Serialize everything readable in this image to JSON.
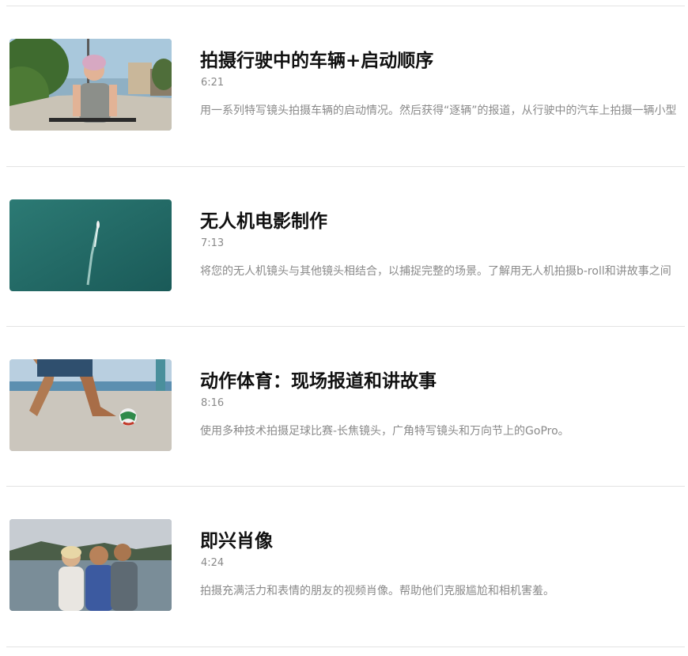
{
  "videos": [
    {
      "title": "拍摄行驶中的车辆+启动顺序",
      "duration": "6:21",
      "description": "用一系列特写镜头拍摄车辆的启动情况。然后获得“逐辆”的报道，从行驶中的汽车上拍摄一辆小型"
    },
    {
      "title": "无人机电影制作",
      "duration": "7:13",
      "description": "将您的无人机镜头与其他镜头相结合，以捕捉完整的场景。了解用无人机拍摄b-roll和讲故事之间"
    },
    {
      "title": "动作体育：现场报道和讲故事",
      "duration": "8:16",
      "description": "使用多种技术拍摄足球比赛-长焦镜头，广角特写镜头和万向节上的GoPro。"
    },
    {
      "title": "即兴肖像",
      "duration": "4:24",
      "description": "拍摄充满活力和表情的朋友的视频肖像。帮助他们克服尴尬和相机害羞。"
    }
  ]
}
